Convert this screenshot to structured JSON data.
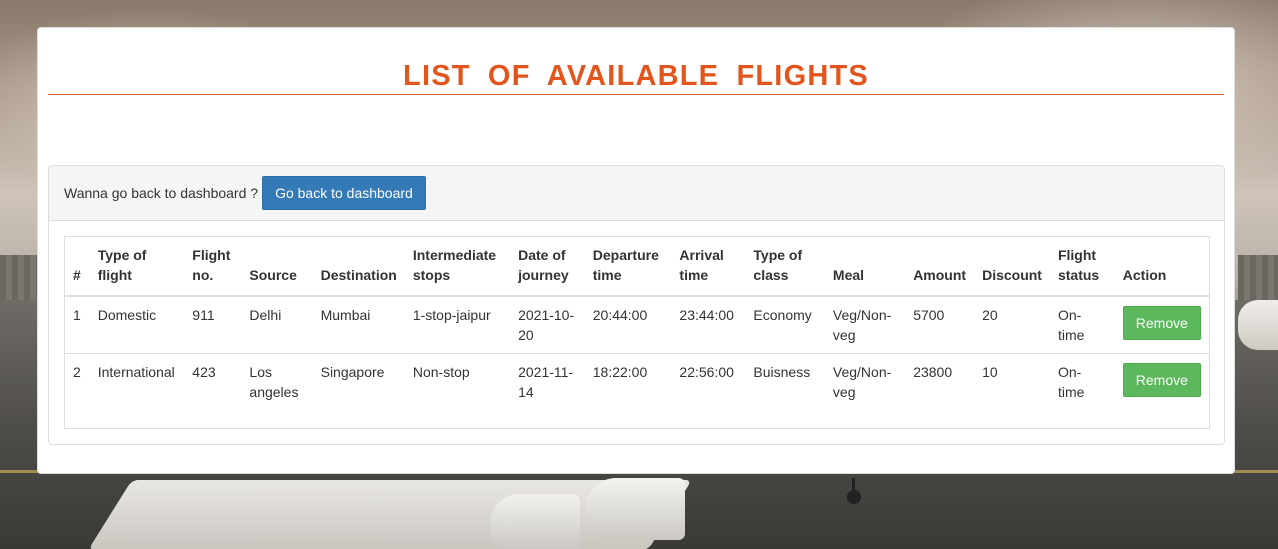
{
  "page": {
    "title": "LIST  OF  AVAILABLE  FLIGHTS"
  },
  "panel": {
    "prompt": "Wanna go back to dashboard ?",
    "back_button": "Go back to dashboard"
  },
  "table": {
    "headers": {
      "num": "#",
      "type_line1": "Type of",
      "type_line2": "flight",
      "flightno_line1": "Flight",
      "flightno_line2": "no.",
      "source": "Source",
      "destination": "Destination",
      "stops_line1": "Intermediate",
      "stops_line2": "stops",
      "date_line1": "Date of",
      "date_line2": "journey",
      "dep_line1": "Departure",
      "dep_line2": "time",
      "arr_line1": "Arrival",
      "arr_line2": "time",
      "class_line1": "Type of",
      "class_line2": "class",
      "meal": "Meal",
      "amount": "Amount",
      "discount": "Discount",
      "status_line1": "Flight",
      "status_line2": "status",
      "action": "Action"
    },
    "rows": [
      {
        "num": "1",
        "type": "Domestic",
        "flight_no": "911",
        "source": "Delhi",
        "destination": "Mumbai",
        "stops": "1-stop-jaipur",
        "date": "2021-10-20",
        "departure": "20:44:00",
        "arrival": "23:44:00",
        "class": "Economy",
        "meal": "Veg/Non-veg",
        "amount": "5700",
        "discount": "20",
        "status": "On-time",
        "action": "Remove"
      },
      {
        "num": "2",
        "type": "International",
        "flight_no": "423",
        "source": "Los angeles",
        "destination": "Singapore",
        "stops": "Non-stop",
        "date": "2021-11-14",
        "departure": "18:22:00",
        "arrival": "22:56:00",
        "class": "Buisness",
        "meal": "Veg/Non-veg",
        "amount": "23800",
        "discount": "10",
        "status": "On-time",
        "action": "Remove"
      }
    ]
  },
  "colors": {
    "title": "#e2561d",
    "primary_button": "#337ab7",
    "success_button": "#5cb85c"
  }
}
